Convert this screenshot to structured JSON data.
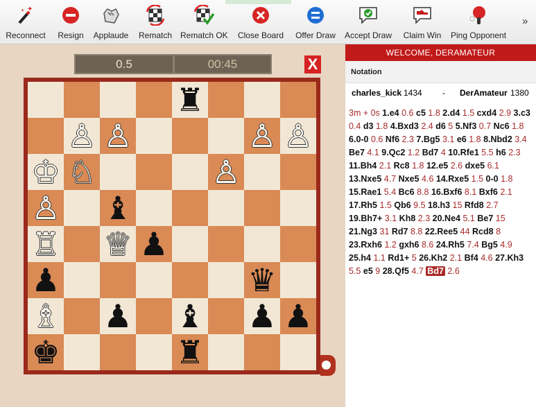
{
  "toolbar": {
    "buttons": [
      {
        "label": "Reconnect",
        "icon": "magic-wand-icon"
      },
      {
        "label": "Resign",
        "icon": "resign-icon"
      },
      {
        "label": "Applaude",
        "icon": "applause-icon"
      },
      {
        "label": "Rematch",
        "icon": "rematch-icon"
      },
      {
        "label": "Rematch OK",
        "icon": "rematch-ok-icon"
      },
      {
        "label": "Close Board",
        "icon": "close-board-icon"
      },
      {
        "label": "Offer Draw",
        "icon": "offer-draw-icon"
      },
      {
        "label": "Accept Draw",
        "icon": "accept-draw-icon"
      },
      {
        "label": "Claim Win",
        "icon": "claim-win-icon"
      },
      {
        "label": "Ping Opponent",
        "icon": "ping-icon"
      }
    ],
    "more": "»"
  },
  "clocks": {
    "left": "0.5",
    "right": "00:45"
  },
  "close_label": "X",
  "board": {
    "light_color": "#f2e7d5",
    "dark_color": "#d98a55",
    "pieces": [
      {
        "sq": "e8",
        "p": "♜",
        "c": "b"
      },
      {
        "sq": "b7",
        "p": "♙",
        "c": "w"
      },
      {
        "sq": "c7",
        "p": "♙",
        "c": "w"
      },
      {
        "sq": "g7",
        "p": "♙",
        "c": "w"
      },
      {
        "sq": "h7",
        "p": "♙",
        "c": "w"
      },
      {
        "sq": "a6",
        "p": "♔",
        "c": "w"
      },
      {
        "sq": "b6",
        "p": "♘",
        "c": "w"
      },
      {
        "sq": "f6",
        "p": "♙",
        "c": "w"
      },
      {
        "sq": "a5",
        "p": "♙",
        "c": "w"
      },
      {
        "sq": "c5",
        "p": "♝",
        "c": "b"
      },
      {
        "sq": "a4",
        "p": "♖",
        "c": "w"
      },
      {
        "sq": "c4",
        "p": "♕",
        "c": "w"
      },
      {
        "sq": "d4",
        "p": "♟",
        "c": "b"
      },
      {
        "sq": "a3",
        "p": "♟",
        "c": "b"
      },
      {
        "sq": "g3",
        "p": "♛",
        "c": "b"
      },
      {
        "sq": "a2",
        "p": "♗",
        "c": "w"
      },
      {
        "sq": "c2",
        "p": "♟",
        "c": "b"
      },
      {
        "sq": "e2",
        "p": "♝",
        "c": "b"
      },
      {
        "sq": "g2",
        "p": "♟",
        "c": "b"
      },
      {
        "sq": "h2",
        "p": "♟",
        "c": "b"
      },
      {
        "sq": "a1",
        "p": "♚",
        "c": "b"
      },
      {
        "sq": "e1",
        "p": "♜",
        "c": "b"
      }
    ]
  },
  "panel": {
    "welcome": "WELCOME, DERAMATEUR",
    "notation_title": "Notation",
    "white_name": "charles_kick",
    "white_rating": "1434",
    "separator": "-",
    "black_name": "DerAmateur",
    "black_rating": "1380",
    "time_control": "3m + 0s",
    "moves": [
      {
        "n": "1.",
        "w": "e4",
        "wt": "0.6",
        "b": "c5",
        "bt": "1.8"
      },
      {
        "n": "2.",
        "w": "d4",
        "wt": "1.5",
        "b": "cxd4",
        "bt": "2.9"
      },
      {
        "n": "3.",
        "w": "c3",
        "wt": "0.4",
        "b": "d3",
        "bt": "1.8"
      },
      {
        "n": "4.",
        "w": "Bxd3",
        "wt": "2.4",
        "b": "d6",
        "bt": "5"
      },
      {
        "n": "5.",
        "w": "Nf3",
        "wt": "0.7",
        "b": "Nc6",
        "bt": "1.8"
      },
      {
        "n": "6.",
        "w": "0-0",
        "wt": "0.6",
        "b": "Nf6",
        "bt": "2.3"
      },
      {
        "n": "7.",
        "w": "Bg5",
        "wt": "3.1",
        "b": "e6",
        "bt": "1.8"
      },
      {
        "n": "8.",
        "w": "Nbd2",
        "wt": "3.4",
        "b": "Be7",
        "bt": "4.1"
      },
      {
        "n": "9.",
        "w": "Qc2",
        "wt": "1.2",
        "b": "Bd7",
        "bt": "4"
      },
      {
        "n": "10.",
        "w": "Rfe1",
        "wt": "5.5",
        "b": "h6",
        "bt": "2.3"
      },
      {
        "n": "11.",
        "w": "Bh4",
        "wt": "2.1",
        "b": "Rc8",
        "bt": "1.8"
      },
      {
        "n": "12.",
        "w": "e5",
        "wt": "2.6",
        "b": "dxe5",
        "bt": "6.1"
      },
      {
        "n": "13.",
        "w": "Nxe5",
        "wt": "4.7",
        "b": "Nxe5",
        "bt": "4.6"
      },
      {
        "n": "14.",
        "w": "Rxe5",
        "wt": "1.5",
        "b": "0-0",
        "bt": "1.8"
      },
      {
        "n": "15.",
        "w": "Rae1",
        "wt": "5.4",
        "b": "Bc6",
        "bt": "8.8"
      },
      {
        "n": "16.",
        "w": "Bxf6",
        "wt": "8.1",
        "b": "Bxf6",
        "bt": "2.1"
      },
      {
        "n": "17.",
        "w": "Rh5",
        "wt": "1.5",
        "b": "Qb6",
        "bt": "9.5"
      },
      {
        "n": "18.",
        "w": "h3",
        "wt": "15",
        "b": "Rfd8",
        "bt": "2.7"
      },
      {
        "n": "19.",
        "w": "Bh7+",
        "wt": "3.1",
        "b": "Kh8",
        "bt": "2.3"
      },
      {
        "n": "20.",
        "w": "Ne4",
        "wt": "5.1",
        "b": "Be7",
        "bt": "15"
      },
      {
        "n": "21.",
        "w": "Ng3",
        "wt": "31",
        "b": "Rd7",
        "bt": "8.8"
      },
      {
        "n": "22.",
        "w": "Ree5",
        "wt": "44",
        "b": "Rcd8",
        "bt": "8"
      },
      {
        "n": "23.",
        "w": "Rxh6",
        "wt": "1.2",
        "b": "gxh6",
        "bt": "8.6"
      },
      {
        "n": "24.",
        "w": "Rh5",
        "wt": "7.4",
        "b": "Bg5",
        "bt": "4.9"
      },
      {
        "n": "25.",
        "w": "h4",
        "wt": "1.1",
        "b": "Rd1+",
        "bt": "5"
      },
      {
        "n": "26.",
        "w": "Kh2",
        "wt": "2.1",
        "b": "Bf4",
        "bt": "4.6"
      },
      {
        "n": "27.",
        "w": "Kh3",
        "wt": "5.5",
        "b": "e5",
        "bt": "9"
      },
      {
        "n": "28.",
        "w": "Qf5",
        "wt": "4.7",
        "b": "Bd7",
        "bt": "2.6",
        "current": "b"
      }
    ]
  }
}
